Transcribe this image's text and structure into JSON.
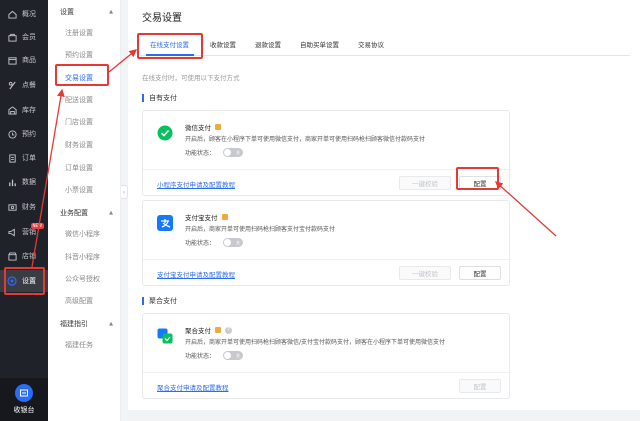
{
  "sidebar": {
    "items": [
      {
        "label": "概况",
        "icon": "home-icon"
      },
      {
        "label": "会员",
        "icon": "member-icon"
      },
      {
        "label": "商品",
        "icon": "goods-icon"
      },
      {
        "label": "点餐",
        "icon": "order-food-icon"
      },
      {
        "label": "库存",
        "icon": "stock-icon"
      },
      {
        "label": "预约",
        "icon": "booking-icon"
      },
      {
        "label": "订单",
        "icon": "orders-icon"
      },
      {
        "label": "数据",
        "icon": "data-icon"
      },
      {
        "label": "财务",
        "icon": "finance-icon"
      },
      {
        "label": "营销",
        "icon": "marketing-icon",
        "badge": "NEW"
      },
      {
        "label": "店铺",
        "icon": "store-icon"
      },
      {
        "label": "设置",
        "icon": "settings-icon",
        "active": true
      }
    ],
    "cashier_label": "收银台"
  },
  "submenu": {
    "groups": [
      {
        "title": "设置",
        "items": [
          "注册设置",
          "预约设置",
          "交易设置",
          "配送设置",
          "门店设置",
          "财务设置",
          "订单设置",
          "小票设置"
        ]
      },
      {
        "title": "业务配置",
        "items": [
          "微信小程序",
          "抖音小程序",
          "公众号授权",
          "高级配置"
        ]
      },
      {
        "title": "福建指引",
        "items": [
          "福建任务"
        ]
      }
    ],
    "active_item": "交易设置"
  },
  "page": {
    "title": "交易设置",
    "tabs": [
      "在线支付设置",
      "收款设置",
      "退款设置",
      "自助买单设置",
      "交易协议"
    ],
    "active_tab": "在线支付设置",
    "hint": "在线支付时，可使用以下支付方式",
    "sections": {
      "self_pay": "自有支付",
      "aggregate_pay": "聚合支付"
    },
    "cards": {
      "wechat": {
        "name": "微信支付",
        "desc": "开启后，顾客在小程序下单可使用微信支付，商家开单可使用扫码枪扫顾客微信付款码支付",
        "func_label": "功能状态：",
        "toggle_text": "关",
        "guide_link": "小程序支付申请及配置教程",
        "check_btn": "一键校验",
        "config_btn": "配置"
      },
      "alipay": {
        "name": "支付宝支付",
        "desc": "开启后，商家开单可使用扫码枪扫顾客支付宝付款码支付",
        "func_label": "功能状态：",
        "toggle_text": "关",
        "guide_link": "支付宝支付申请及配置教程",
        "check_btn": "一键校验",
        "config_btn": "配置"
      },
      "aggregate": {
        "name": "聚合支付",
        "desc": "开启后，商家开单可使用扫码枪扫顾客微信/支付宝付款码支付，顾客在小程序下单可使用微信支付",
        "func_label": "功能状态：",
        "toggle_text": "关",
        "guide_link": "聚合支付申请及配置教程",
        "config_btn": "配置"
      }
    }
  },
  "colors": {
    "accent": "#2b6cf5",
    "annotation_red": "#e53935",
    "wechat_green": "#07c160",
    "alipay_blue": "#1677ff"
  }
}
